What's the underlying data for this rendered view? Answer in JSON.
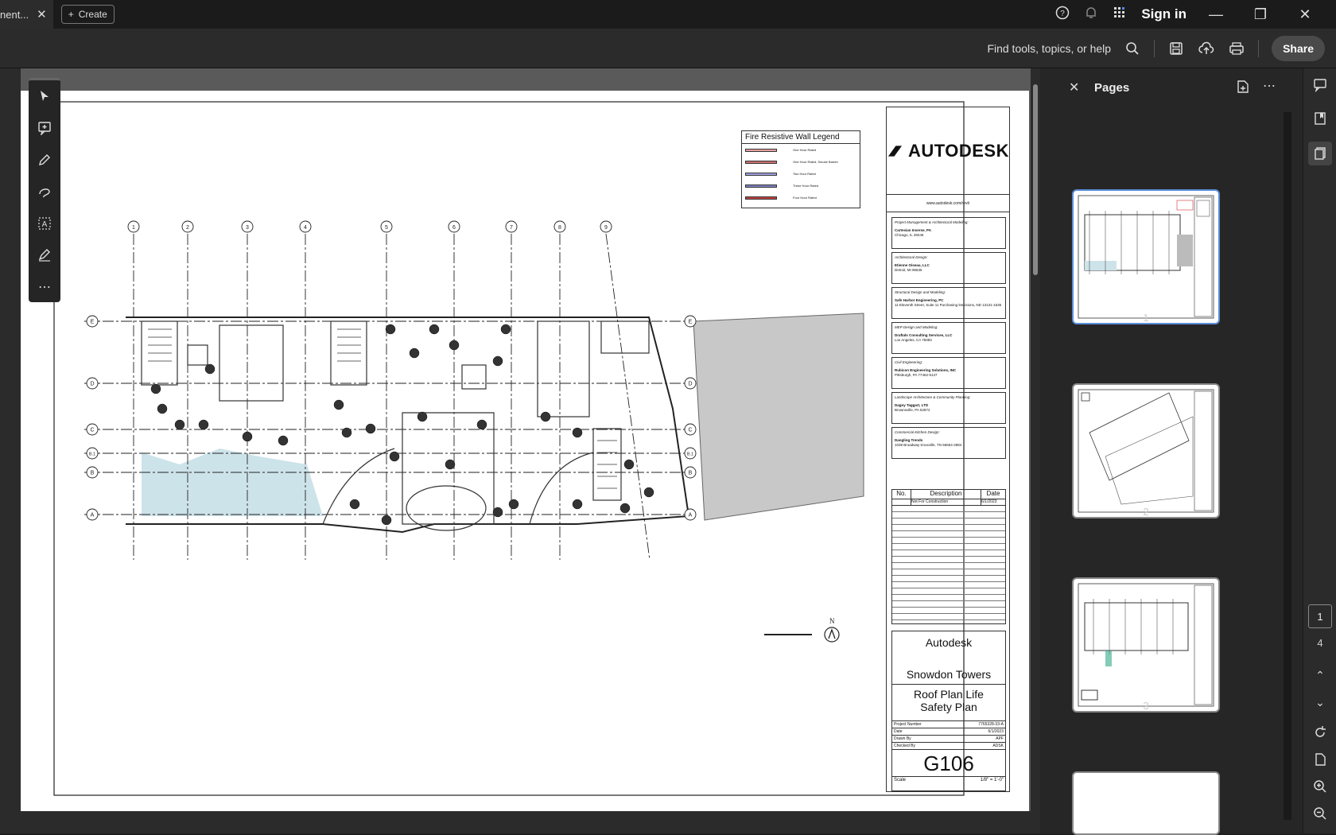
{
  "tab": {
    "title": "nent...",
    "close": "✕"
  },
  "create_label": "Create",
  "header": {
    "signin": "Sign in"
  },
  "toolbar": {
    "find_placeholder": "Find tools, topics, or help",
    "share": "Share"
  },
  "panel": {
    "title": "Pages",
    "pages": [
      "1",
      "2",
      "3"
    ]
  },
  "nav": {
    "current_page": "1",
    "total_pages": "4"
  },
  "drawing": {
    "legend_title": "Fire Resistive Wall Legend",
    "legend_rows": [
      "One Hour Rated",
      "One Hour Rated, Smoke Barrier",
      "Two Hour Rated",
      "Three Hour Rated",
      "Four Hour Rated"
    ],
    "grid_cols": [
      "1",
      "2",
      "3",
      "4",
      "5",
      "6",
      "7",
      "8",
      "9"
    ],
    "grid_rows": [
      "E",
      "D",
      "C",
      "B.1",
      "B",
      "A"
    ],
    "north": "N"
  },
  "titleblock": {
    "brand": "AUTODESK",
    "url": "www.autodesk.com/revit",
    "consultants": [
      {
        "role": "Project Management & Architectural Modeling:",
        "name": "Cartesian Inverse, PA",
        "addr": "Chicago, IL 28246"
      },
      {
        "role": "Architectural Design:",
        "name": "Etienne Oiseau, LLC",
        "addr": "Detroit, MI 96635"
      },
      {
        "role": "Structural Design and Modeling:",
        "name": "Safe Harbor Engineering, PC",
        "addr": "11 Eleventh Street, Suite 11 Purchasing Decisions, ND 13131-1535"
      },
      {
        "role": "MEP Design and Modeling:",
        "name": "Draftals Consulting Services, LLC",
        "addr": "Los Angeles, CA 78383"
      },
      {
        "role": "Civil Engineering:",
        "name": "Rubicon Engineering Solutions, INC",
        "addr": "Pittsburgh, PA 77462-5147"
      },
      {
        "role": "Landscape Architecture & Community Planning:",
        "name": "Dagny Taggart, LTD",
        "addr": "Brownsville, PA 52872"
      },
      {
        "role": "Commercial Kitchen Design:",
        "name": "Dangling Trends",
        "addr": "1038 Broadway Knoxville, TN 56664-2884"
      }
    ],
    "rev_headers": [
      "No.",
      "Description",
      "Date"
    ],
    "rev_rows": [
      {
        "no": "",
        "desc": "Not For Construction",
        "date": "6/1/2023"
      }
    ],
    "client": "Autodesk",
    "project": "Snowdon Towers",
    "sheet_title": "Roof Plan Life Safety Plan",
    "project_number_label": "Project Number",
    "project_number": "7765328-33-A",
    "date_label": "Date",
    "date": "6/1/2023",
    "drawn_label": "Drawn By",
    "drawn": "APF",
    "checked_label": "Checked By",
    "checked": "ADSK",
    "sheet_number": "G106",
    "scale_label": "Scale",
    "scale": "1/8\" = 1'-0\""
  }
}
